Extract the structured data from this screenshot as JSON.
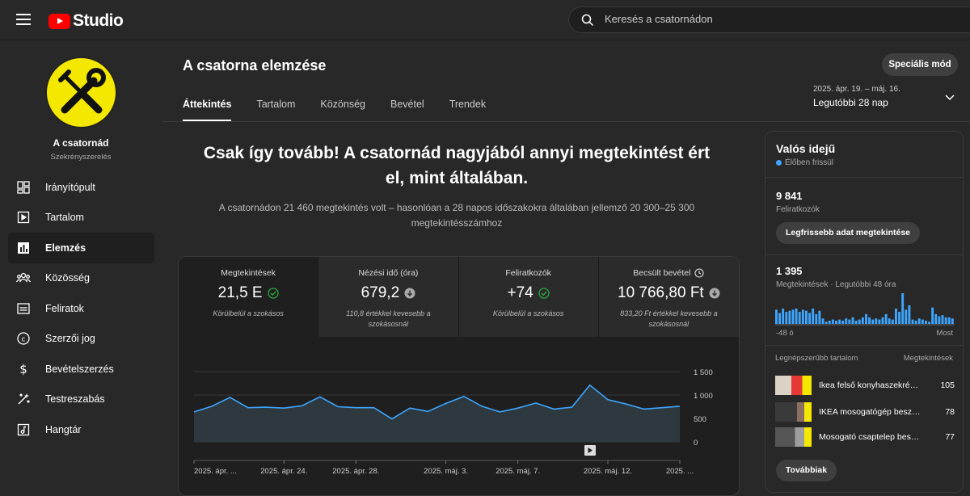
{
  "topbar": {
    "logo_text": "Studio",
    "search_placeholder": "Keresés a csatornádon"
  },
  "sidebar": {
    "channel_name": "A csatornád",
    "channel_sub": "Szekrényszerelés",
    "items": [
      {
        "label": "Irányítópult",
        "icon": "dashboard-icon"
      },
      {
        "label": "Tartalom",
        "icon": "content-icon"
      },
      {
        "label": "Elemzés",
        "icon": "analytics-icon",
        "active": true
      },
      {
        "label": "Közösség",
        "icon": "community-icon"
      },
      {
        "label": "Feliratok",
        "icon": "subtitles-icon"
      },
      {
        "label": "Szerzői jog",
        "icon": "copyright-icon"
      },
      {
        "label": "Bevételszerzés",
        "icon": "monetization-icon"
      },
      {
        "label": "Testreszabás",
        "icon": "customization-icon"
      },
      {
        "label": "Hangtár",
        "icon": "audio-library-icon"
      }
    ]
  },
  "header": {
    "title": "A csatorna elemzése",
    "special_mode": "Speciális mód",
    "tabs": [
      "Áttekintés",
      "Tartalom",
      "Közönség",
      "Bevétel",
      "Trendek"
    ],
    "date_range": "2025. ápr. 19. – máj. 16.",
    "date_label": "Legutóbbi 28 nap"
  },
  "summary": {
    "headline": "Csak így tovább! A csatornád nagyjából annyi megtekintést ért el, mint általában.",
    "subline": "A csatornádon 21 460 megtekintés volt – hasonlóan a 28 napos időszakokra általában jellemző 20 300–25 300 megtekintésszámhoz"
  },
  "metrics": [
    {
      "label": "Megtekintések",
      "value": "21,5 E",
      "status": "ok",
      "note": "Körülbelül a szokásos"
    },
    {
      "label": "Nézési idő (óra)",
      "value": "679,2",
      "status": "down",
      "note": "110,8 értékkel kevesebb a szokásosnál"
    },
    {
      "label": "Feliratkozók",
      "value": "+74",
      "status": "ok",
      "note": "Körülbelül a szokásos"
    },
    {
      "label": "Becsült bevétel",
      "value": "10 766,80 Ft",
      "status": "down",
      "note": "833,20 Ft értékkel kevesebb a szokásosnál"
    }
  ],
  "chart_data": {
    "type": "area",
    "ylim": [
      0,
      1500
    ],
    "y_ticks": [
      "1 500",
      "1 000",
      "500",
      "0"
    ],
    "x_tick_labels": [
      "2025. ápr. ...",
      "2025. ápr. 24.",
      "2025. ápr. 28.",
      "2025. máj. 3.",
      "2025. máj. 7.",
      "2025. máj. 12.",
      "2025. ..."
    ],
    "series": [
      {
        "values": [
          640,
          760,
          950,
          730,
          740,
          720,
          770,
          960,
          750,
          730,
          730,
          490,
          720,
          650,
          820,
          970,
          760,
          640,
          720,
          830,
          700,
          740,
          1210,
          900,
          810,
          700,
          730,
          760
        ]
      }
    ],
    "color": "#3ea6ff"
  },
  "realtime": {
    "title": "Valós idejű",
    "live_label": "Élőben frissül",
    "subscribers": "9 841",
    "subscribers_label": "Feliratkozók",
    "latest_btn": "Legfrissebb adat megtekintése",
    "views": "1 395",
    "views_label": "Megtekintések · Legutóbbi 48 óra",
    "axis_left": "-48 ó",
    "axis_right": "Most",
    "bars": [
      13,
      10,
      14,
      11,
      12,
      13,
      14,
      11,
      13,
      12,
      10,
      14,
      9,
      12,
      5,
      2,
      3,
      4,
      3,
      4,
      3,
      5,
      4,
      6,
      3,
      4,
      6,
      9,
      6,
      4,
      5,
      4,
      6,
      9,
      5,
      4,
      14,
      11,
      28,
      13,
      17,
      4,
      3,
      5,
      4,
      3,
      2,
      15,
      9,
      7,
      8,
      6,
      6,
      5
    ],
    "top_header_left": "Legnépszerűbb tartalom",
    "top_header_right": "Megtekintések",
    "top_items": [
      {
        "title": "Ikea felső konyhaszekrény ...",
        "count": "105"
      },
      {
        "title": "IKEA mosogatógép beszerel...",
        "count": "78"
      },
      {
        "title": "Mosogató csaptelep beszer...",
        "count": "77"
      }
    ],
    "more_btn": "Továbbiak"
  }
}
